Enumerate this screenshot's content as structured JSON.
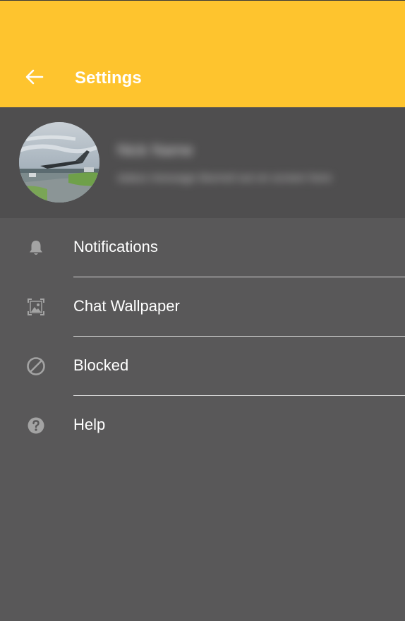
{
  "header": {
    "title": "Settings",
    "back_icon": "back-arrow-icon",
    "color": "#fec42e"
  },
  "profile": {
    "name": "Nick Name",
    "status": "status message blurred out on screen here"
  },
  "menu": {
    "items": [
      {
        "label": "Notifications",
        "icon": "bell-icon"
      },
      {
        "label": "Chat Wallpaper",
        "icon": "wallpaper-icon"
      },
      {
        "label": "Blocked",
        "icon": "blocked-icon"
      },
      {
        "label": "Help",
        "icon": "help-icon"
      }
    ]
  },
  "colors": {
    "background": "#595859",
    "profile_background": "#4f4e4f",
    "icon": "#a3a3a3",
    "text": "#ffffff"
  }
}
